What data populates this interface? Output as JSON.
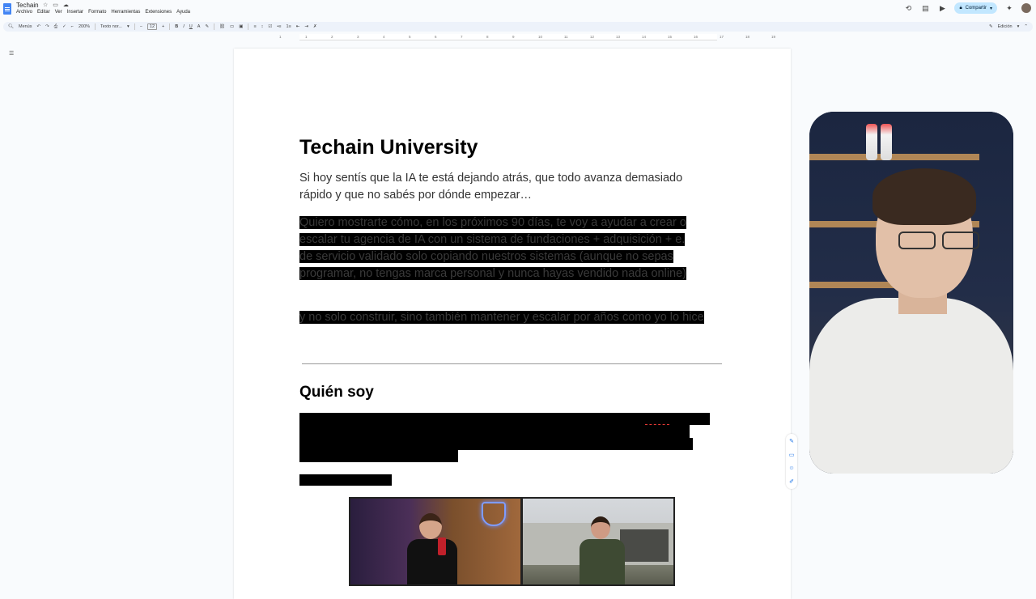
{
  "app": {
    "doc_title": "Techain",
    "menu": [
      "Archivo",
      "Editar",
      "Ver",
      "Insertar",
      "Formato",
      "Herramientas",
      "Extensiones",
      "Ayuda"
    ],
    "share_label": "Compartir",
    "mode_label": "Edición"
  },
  "toolbar": {
    "menus_label": "Menús",
    "zoom": "200%",
    "style": "Texto nor...",
    "font_size": "12"
  },
  "ruler": {
    "ticks": [
      "1",
      "1",
      "2",
      "3",
      "4",
      "5",
      "6",
      "7",
      "8",
      "9",
      "10",
      "11",
      "12",
      "13",
      "14",
      "15",
      "16",
      "17",
      "18",
      "19"
    ]
  },
  "document": {
    "title": "Techain University",
    "intro": "Si hoy sentís que la IA te está dejando atrás, que todo avanza demasiado rápido y que no sabés por dónde empezar…",
    "selected_paragraph_1": "Quiero mostrarte cómo, en los próximos 90 días, te voy a ayudar a crear o escalar tu agencia de IA con un sistema de fundaciones + adquisición + e. de servicio validado solo copiando nuestros sistemas (aunque no sepas programar, no tengas marca personal y nunca hayas vendido nada online)",
    "selected_paragraph_2": "y no solo construir, sino también mantener y escalar por años como yo lo hice",
    "section_heading": "Quién soy"
  },
  "colors": {
    "accent": "#1a73e8",
    "share_bg": "#c2e7ff",
    "selection": "#000000"
  }
}
